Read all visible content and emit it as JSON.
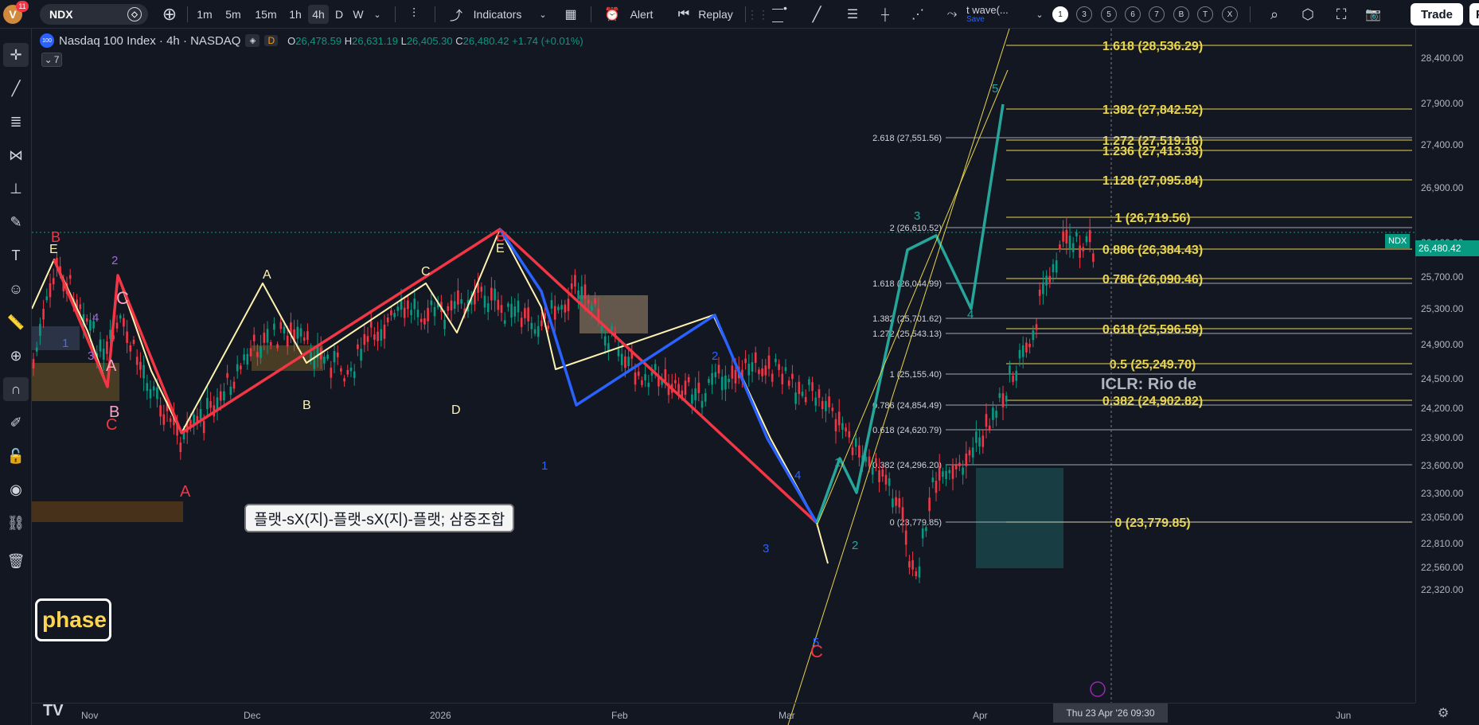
{
  "topbar": {
    "avatar_letter": "V",
    "notification_count": "11",
    "symbol": "NDX",
    "timeframes": [
      "1m",
      "5m",
      "15m",
      "1h",
      "4h",
      "D",
      "W"
    ],
    "active_timeframe": "4h",
    "indicators_label": "Indicators",
    "alert_label": "Alert",
    "replay_label": "Replay",
    "layout_title": "t wave(...",
    "save_label": "Save",
    "presets": [
      "1",
      "3",
      "5",
      "6",
      "7",
      "B",
      "T",
      "X"
    ],
    "trade_label": "Trade",
    "publish_label": "Pu"
  },
  "legend": {
    "logo_text": "100",
    "title": "Nasdaq 100 Index · 4h · NASDAQ",
    "badge": "D",
    "open": "26,478.59",
    "high": "26,631.19",
    "low": "26,405.30",
    "close": "26,480.42",
    "change": "+1.74 (+0.01%)",
    "o_label": "O",
    "h_label": "H",
    "l_label": "L",
    "c_label": "C",
    "collapse_count": "7"
  },
  "annotations": {
    "callout": "플랫-sX(지)-플랫-sX(지)-플랫; 삼중조합",
    "phase": "phase",
    "iclr": "ICLR: Rio de"
  },
  "price_axis": {
    "labels": [
      "28,400.00",
      "27,900.00",
      "27,400.00",
      "26,900.00",
      "26,100.00",
      "25,700.00",
      "25,300.00",
      "24,900.00",
      "24,500.00",
      "24,200.00",
      "23,900.00",
      "23,600.00",
      "23,300.00",
      "23,050.00",
      "22,810.00",
      "22,560.00",
      "22,320.00"
    ],
    "last_price": "26,480.42",
    "symbol_tag": "NDX"
  },
  "time_axis": {
    "labels": [
      "Nov",
      "Dec",
      "2026",
      "Feb",
      "Mar",
      "Apr",
      "Jun"
    ],
    "crosshair": "Thu 23 Apr '26   09:30"
  },
  "fib_right": [
    "1.618 (28,536.29)",
    "1.382 (27,842.52)",
    "1.272 (27,519.16)",
    "1.236 (27,413.33)",
    "1.128 (27,095.84)",
    "1 (26,719.56)",
    "0.886 (26,384.43)",
    "0.786 (26,090.46)",
    "0.618 (25,596.59)",
    "0.5 (25,249.70)",
    "0.382 (24,902.82)",
    "0 (23,779.85)"
  ],
  "fib_left": [
    "2.618 (27,551.56)",
    "2 (26,610.52)",
    "1.618 (26,044.99)",
    "1.382 (25,701.62)",
    "1.272 (25,543.13)",
    "1 (25,155.40)",
    "0.786 (24,854.49)",
    "0.618 (24,620.79)",
    "0.382 (24,296.20)",
    "0 (23,779.85)"
  ],
  "wave_labels": {
    "red_top1": "B",
    "red_top1_e": "E",
    "red_c_mid": "C",
    "red_b1": "B",
    "red_c1": "C",
    "red_a1": "A",
    "red_a2": "A",
    "cream_a": "A",
    "cream_b": "B",
    "cream_c": "C",
    "cream_d": "D",
    "red_top2": "B",
    "red_top2_e": "E",
    "blue_1": "1",
    "blue_2": "2",
    "blue_3": "3",
    "blue_4": "4",
    "red_end_c": "C",
    "blue_5": "5",
    "purple_1": "1",
    "purple_2": "2",
    "purple_3": "3",
    "purple_4": "4",
    "teal_1": "1",
    "teal_2": "2",
    "teal_3": "3",
    "teal_4": "4",
    "teal_5": "5"
  },
  "colors": {
    "background": "#131722",
    "up": "#089981",
    "down": "#f23645",
    "fib": "#e8d44d",
    "red_wave": "#f23645",
    "blue_wave": "#2962ff",
    "cream_wave": "#fff3b0",
    "teal_wave": "#26a69a"
  }
}
